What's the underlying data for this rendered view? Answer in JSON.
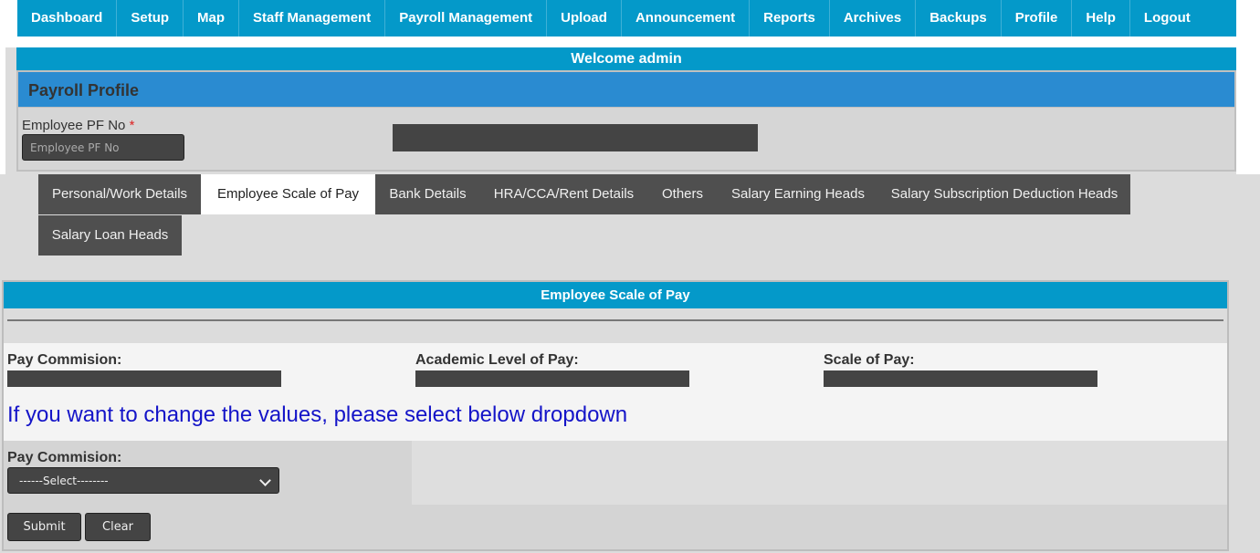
{
  "nav": {
    "items": [
      "Dashboard",
      "Setup",
      "Map",
      "Staff Management",
      "Payroll Management",
      "Upload",
      "Announcement",
      "Reports",
      "Archives",
      "Backups",
      "Profile",
      "Help",
      "Logout"
    ]
  },
  "welcome": "Welcome admin",
  "profile": {
    "title": "Payroll Profile",
    "pf_label": "Employee PF No",
    "required_mark": "*",
    "pf_placeholder": "Employee PF No",
    "pf_value": ""
  },
  "tabs": {
    "items": [
      "Personal/Work Details",
      "Employee Scale of Pay",
      "Bank Details",
      "HRA/CCA/Rent Details",
      "Others",
      "Salary Earning Heads",
      "Salary Subscription Deduction Heads",
      "Salary Loan Heads"
    ],
    "active": "Employee Scale of Pay"
  },
  "scale": {
    "title": "Employee Scale of Pay",
    "pay_commission_label": "Pay Commision:",
    "academic_level_label": "Academic Level of Pay:",
    "scale_of_pay_label": "Scale of Pay:",
    "notice": "If you want to change the values, please select below dropdown",
    "select_label": "Pay Commision:",
    "select_value": "------Select--------",
    "submit_label": "Submit",
    "clear_label": "Clear"
  },
  "colors": {
    "nav_bg": "#0499c9",
    "profile_header": "#2a8bd1",
    "notice_text": "#1414c8",
    "control_dark": "#444444"
  },
  "icons": {
    "select_arrow": "chevron-down-icon"
  }
}
